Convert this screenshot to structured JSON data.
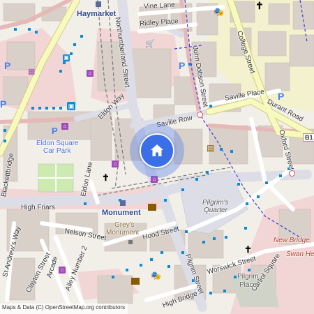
{
  "map": {
    "labels": {
      "haymarket": "Haymarket",
      "vine_lane": "Vine Lane",
      "ridley_place": "Ridley Place",
      "northumberland_street": "Northumberland Street",
      "college_street": "College Street",
      "john_dobson_street": "John Dobson Street",
      "saville_place": "Saville Place",
      "durant_road": "Durant Road",
      "saville_row": "Saville Row",
      "eldon_way": "Eldon Way",
      "eldon_square_car_park_1": "Eldon Square",
      "eldon_square_car_park_2": "Car Park",
      "oxford_street": "Oxford Street",
      "blackettbridge": "Blackettbridge",
      "eldon_lane": "Eldon Lane",
      "high_friars": "High Friars",
      "monument": "Monument",
      "greys_monument_1": "Grey's",
      "greys_monument_2": "Monument",
      "pilgrims_quarter_1": "Pilgrim's",
      "pilgrims_quarter_2": "Quarter",
      "nelson_street": "Nelson Street",
      "hood_street": "Hood Street",
      "new_bridge": "New Bridge",
      "swan_house": "Swan He",
      "st_andrews_way": "St Andrew's Way",
      "clayton_street": "Clayton Street",
      "arcade": "Arcade",
      "alley_number_2": "Alley Number 2",
      "worswick_street": "Worswick Street",
      "carliol_square": "Carliol Square",
      "pilgrim_place_1": "Pilgrim",
      "pilgrim_place_2": "Place",
      "pilgrim_street": "Pilgrim Street",
      "high_bridge": "High Bridge",
      "route_b1": "B1"
    },
    "parking_symbol": "P",
    "attribution": "Maps & Data (C) OpenStreetMap.org contributors"
  },
  "colors": {
    "background": "#f2efe9",
    "building": "#d9d0c9",
    "pedestrian": "#dddde8",
    "road_yellow": "#f7fabf",
    "road_yellow_edge": "#d8c87e",
    "road_pink": "#f2d5d5",
    "bus_stop": "#0a8bd8",
    "location": "#3a6fe8",
    "park": "#cdebb0",
    "church_area": "#f7c3b4"
  },
  "icons": {
    "location": "home-icon",
    "church": "cross-icon",
    "theatre": "theatre-masks-icon",
    "cinema": "film-icon",
    "library": "book-icon",
    "shop": "shopping-bag-icon",
    "mall": "shopping-cart-icon",
    "bus": "bus-icon",
    "parking": "parking-icon"
  }
}
